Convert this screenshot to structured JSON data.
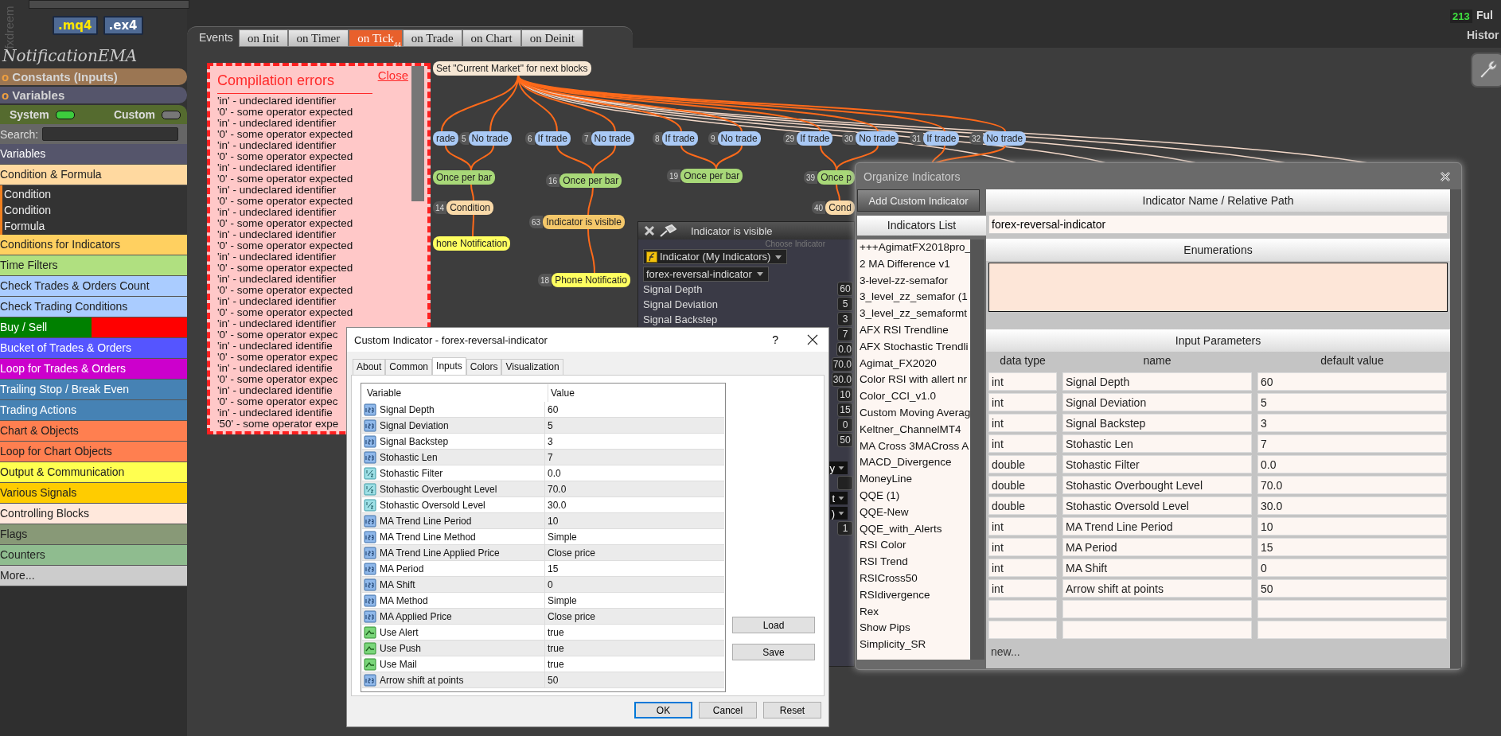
{
  "header": {
    "logo": "fxdreem",
    "file_buttons": [
      ".mq4",
      ".ex4"
    ],
    "counter": "213",
    "mode_label": "Ful",
    "history_label": "Histor"
  },
  "sidebar": {
    "project_title": "NotificationEMA",
    "sections": [
      {
        "marker": "o",
        "label": "Constants (Inputs)",
        "color": "#9b7653"
      },
      {
        "marker": "o",
        "label": "Variables",
        "color": "#55556b"
      }
    ],
    "toggles": [
      {
        "label": "System",
        "on": true
      },
      {
        "label": "Custom",
        "on": false
      }
    ],
    "search": {
      "label": "Search:"
    },
    "categories": [
      {
        "label": "Variables",
        "color": "#55556b"
      },
      {
        "label": "Condition & Formula",
        "color": "#ffd9a0",
        "children": [
          {
            "label": "Condition"
          },
          {
            "label": "Condition"
          },
          {
            "label": "Formula"
          }
        ]
      },
      {
        "label": "Conditions for Indicators",
        "color": "#ffd060"
      },
      {
        "label": "Time Filters",
        "color": "#b0e080"
      },
      {
        "label": "Check Trades & Orders Count",
        "color": "#aaccff"
      },
      {
        "label": "Check Trading Conditions",
        "color": "#aaccff"
      },
      {
        "label": "Buy / Sell",
        "color": "#008000",
        "segments": [
          {
            "color": "#ff0000"
          }
        ]
      },
      {
        "label": "Bucket of Trades & Orders",
        "color": "#5555ff"
      },
      {
        "label": "Loop for Trades & Orders",
        "color": "#cc00cc"
      },
      {
        "label": "Trailing Stop / Break Even",
        "color": "#4682b4"
      },
      {
        "label": "Trading Actions",
        "color": "#4682b4"
      },
      {
        "label": "Chart & Objects",
        "color": "#ff7f50"
      },
      {
        "label": "Loop for Chart Objects",
        "color": "#ff7f50"
      },
      {
        "label": "Output & Communication",
        "color": "#ffff50"
      },
      {
        "label": "Various Signals",
        "color": "#ffcc00"
      },
      {
        "label": "Controlling Blocks",
        "color": "#ffe8dc"
      },
      {
        "label": "Flags",
        "color": "#889977"
      },
      {
        "label": "Counters",
        "color": "#8fbc8f"
      },
      {
        "label": "More...",
        "color": "#cccccc"
      }
    ]
  },
  "canvas": {
    "events_label": "Events",
    "tabs": [
      {
        "label": "on Init",
        "selected": false
      },
      {
        "label": "on Timer",
        "selected": false
      },
      {
        "label": "on Tick",
        "selected": true,
        "badge": "44"
      },
      {
        "label": "on Trade",
        "selected": false
      },
      {
        "label": "on Chart",
        "selected": false
      },
      {
        "label": "on Deinit",
        "selected": false
      }
    ],
    "nodes": [
      {
        "label": "Set \"Current Market\" for next blocks",
        "kind": "market"
      },
      {
        "label": "rade",
        "kind": "trade"
      },
      {
        "number": "5",
        "label": "No trade",
        "kind": "trade"
      },
      {
        "number": "6",
        "label": "If trade",
        "kind": "trade"
      },
      {
        "number": "7",
        "label": "No trade",
        "kind": "trade"
      },
      {
        "number": "8",
        "label": "If trade",
        "kind": "trade"
      },
      {
        "number": "9",
        "label": "No trade",
        "kind": "trade"
      },
      {
        "number": "29",
        "label": "If trade",
        "kind": "trade"
      },
      {
        "number": "30",
        "label": "No trade",
        "kind": "trade"
      },
      {
        "number": "31",
        "label": "If trade",
        "kind": "trade"
      },
      {
        "number": "32",
        "label": "No trade",
        "kind": "trade"
      },
      {
        "label": "Once per bar",
        "kind": "once"
      },
      {
        "number": "16",
        "label": "Once per bar",
        "kind": "once"
      },
      {
        "number": "19",
        "label": "Once per bar",
        "kind": "once"
      },
      {
        "number": "39",
        "label": "Once p",
        "kind": "once"
      },
      {
        "number": "14",
        "label": "Condition",
        "kind": "condition"
      },
      {
        "number": "40",
        "label": "Cond",
        "kind": "condition"
      },
      {
        "number": "63",
        "label": "Indicator is visible",
        "kind": "visible"
      },
      {
        "label": "hone Notification",
        "kind": "notification"
      },
      {
        "number": "18",
        "label": "Phone Notificatio",
        "kind": "notification"
      }
    ]
  },
  "errors": {
    "title": "Compilation errors",
    "close": "Close",
    "lines": [
      "'in' - undeclared identifier",
      "'0' - some operator expected",
      "'in' - undeclared identifier",
      "'0' - some operator expected",
      "'in' - undeclared identifier",
      "'0' - some operator expected",
      "'in' - undeclared identifier",
      "'0' - some operator expected",
      "'in' - undeclared identifier",
      "'0' - some operator expected",
      "'in' - undeclared identifier",
      "'0' - some operator expected",
      "'in' - undeclared identifier",
      "'0' - some operator expected",
      "'in' - undeclared identifier",
      "'0' - some operator expected",
      "'in' - undeclared identifier",
      "'0' - some operator expected",
      "'in' - undeclared identifier",
      "'0' - some operator expected",
      "'in' - undeclared identifier",
      "'0' - some operator expec",
      "'in' - undeclared identifie",
      "'0' - some operator expec",
      "'in' - undeclared identifie",
      "'0' - some operator expec",
      "'in' - undeclared identifie",
      "'0' - some operator expec",
      "'in' - undeclared identifie",
      "'50' - some operator expe"
    ]
  },
  "indicator_panel": {
    "title": "Indicator is visible",
    "section": "Choose Indicator",
    "source": "Indicator (My Indicators)",
    "indicator": "forex-reversal-indicator",
    "params": [
      {
        "label": "Signal Depth",
        "value": "60"
      },
      {
        "label": "Signal Deviation",
        "value": "5"
      },
      {
        "label": "Signal Backstep",
        "value": "3"
      },
      {
        "value": "7"
      },
      {
        "value": "0.0"
      },
      {
        "value": "70.0"
      },
      {
        "value": "30.0"
      },
      {
        "value": "10"
      },
      {
        "value": "15"
      },
      {
        "value": "0"
      },
      {
        "value": "50"
      }
    ],
    "controls": [
      {
        "kind": "dropdown",
        "value": "y"
      },
      {
        "kind": "box"
      },
      {
        "kind": "dropdown",
        "value": "t"
      },
      {
        "kind": "dropdown",
        "value": ")"
      },
      {
        "kind": "box",
        "value": "1"
      }
    ]
  },
  "custom_dialog": {
    "title": "Custom Indicator - forex-reversal-indicator",
    "help": "?",
    "tabs": [
      {
        "label": "About",
        "selected": false
      },
      {
        "label": "Common",
        "selected": false
      },
      {
        "label": "Inputs",
        "selected": true
      },
      {
        "label": "Colors",
        "selected": false
      },
      {
        "label": "Visualization",
        "selected": false
      }
    ],
    "columns": [
      "Variable",
      "Value"
    ],
    "rows": [
      {
        "kind": "int",
        "variable": "Signal Depth",
        "value": "60"
      },
      {
        "kind": "int",
        "variable": "Signal Deviation",
        "value": "5"
      },
      {
        "kind": "int",
        "variable": "Signal Backstep",
        "value": "3"
      },
      {
        "kind": "int",
        "variable": "Stohastic Len",
        "value": "7"
      },
      {
        "kind": "double",
        "variable": "Stohastic Filter",
        "value": "0.0"
      },
      {
        "kind": "double",
        "variable": "Stohastic Overbought Level",
        "value": "70.0"
      },
      {
        "kind": "double",
        "variable": "Stohastic Oversold Level",
        "value": "30.0"
      },
      {
        "kind": "int",
        "variable": "MA Trend Line Period",
        "value": "10"
      },
      {
        "kind": "int",
        "variable": "MA Trend Line Method",
        "value": "Simple"
      },
      {
        "kind": "int",
        "variable": "MA Trend Line Applied Price",
        "value": "Close price"
      },
      {
        "kind": "int",
        "variable": "MA Period",
        "value": "15"
      },
      {
        "kind": "int",
        "variable": "MA Shift",
        "value": "0"
      },
      {
        "kind": "int",
        "variable": "MA Method",
        "value": "Simple"
      },
      {
        "kind": "int",
        "variable": "MA Applied Price",
        "value": "Close price"
      },
      {
        "kind": "bool",
        "variable": "Use Alert",
        "value": "true"
      },
      {
        "kind": "bool",
        "variable": "Use Push",
        "value": "true"
      },
      {
        "kind": "bool",
        "variable": "Use Mail",
        "value": "true"
      },
      {
        "kind": "int",
        "variable": "Arrow shift at points",
        "value": "50"
      }
    ],
    "side_buttons": [
      "Load",
      "Save"
    ],
    "buttons": [
      {
        "label": "OK",
        "default": true
      },
      {
        "label": "Cancel",
        "default": false
      },
      {
        "label": "Reset",
        "default": false
      }
    ]
  },
  "organize": {
    "title": "Organize Indicators",
    "add_button": "Add Custom Indicator",
    "list_title": "Indicators List",
    "indicators": [
      "+++AgimatFX2018pro_",
      "2 MA Difference v1",
      "3-level-zz-semafor",
      "3_level_zz_semafor (1",
      "3_level_zz_semaformt",
      "AFX RSI Trendline",
      "AFX Stochastic Trendli",
      "Agimat_FX2020",
      "Color RSI with allert nr",
      "Color_CCI_v1.0",
      "Custom Moving Averag",
      "Keltner_ChannelMT4",
      "MA Cross 3MACross A",
      "MACD_Divergence",
      "MoneyLine",
      "QQE (1)",
      "QQE-New",
      "QQE_with_Alerts",
      "RSI Color",
      "RSI Trend",
      "RSICross50",
      "RSIdivergence",
      "Rex",
      "Show Pips",
      "Simplicity_SR"
    ],
    "path_title": "Indicator Name / Relative Path",
    "path_value": "forex-reversal-indicator",
    "enumerations_title": "Enumerations",
    "inputs_title": "Input Parameters",
    "columns": [
      "data type",
      "name",
      "default value"
    ],
    "params": [
      {
        "kind": "filled",
        "type": "int",
        "name": "Signal Depth",
        "default": "60"
      },
      {
        "kind": "filled",
        "type": "int",
        "name": "Signal Deviation",
        "default": "5"
      },
      {
        "kind": "filled",
        "type": "int",
        "name": "Signal Backstep",
        "default": "3"
      },
      {
        "kind": "filled",
        "type": "int",
        "name": "Stohastic Len",
        "default": "7"
      },
      {
        "kind": "filled",
        "type": "double",
        "name": "Stohastic Filter",
        "default": "0.0"
      },
      {
        "kind": "filled",
        "type": "double",
        "name": "Stohastic Overbought Level",
        "default": "70.0"
      },
      {
        "kind": "filled",
        "type": "double",
        "name": "Stohastic Oversold Level",
        "default": "30.0"
      },
      {
        "kind": "filled",
        "type": "int",
        "name": "MA Trend Line Period",
        "default": "10"
      },
      {
        "kind": "filled",
        "type": "int",
        "name": "MA Period",
        "default": "15"
      },
      {
        "kind": "filled",
        "type": "int",
        "name": "MA Shift",
        "default": "0"
      },
      {
        "kind": "filled",
        "type": "int",
        "name": "Arrow shift at points",
        "default": "50"
      },
      {
        "kind": "blank"
      },
      {
        "kind": "blank"
      }
    ],
    "new_link": "new..."
  }
}
